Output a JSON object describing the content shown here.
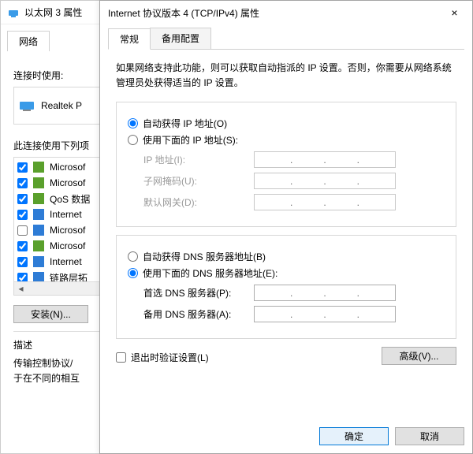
{
  "back": {
    "title": "以太网 3 属性",
    "tab_network": "网络",
    "connect_using_label": "连接时使用:",
    "adapter_name": "Realtek P",
    "items_label": "此连接使用下列项",
    "items": [
      {
        "checked": true,
        "label": "Microsof"
      },
      {
        "checked": true,
        "label": "Microsof"
      },
      {
        "checked": true,
        "label": "QoS 数据"
      },
      {
        "checked": true,
        "label": "Internet"
      },
      {
        "checked": false,
        "label": "Microsof"
      },
      {
        "checked": true,
        "label": "Microsof"
      },
      {
        "checked": true,
        "label": "Internet"
      },
      {
        "checked": true,
        "label": "链路层拓"
      }
    ],
    "install_btn": "安装(N)...",
    "desc_heading": "描述",
    "desc_text": "传输控制协议/\n于在不同的相互"
  },
  "front": {
    "title": "Internet 协议版本 4 (TCP/IPv4) 属性",
    "close": "×",
    "tab_general": "常规",
    "tab_alt": "备用配置",
    "help": "如果网络支持此功能，则可以获取自动指派的 IP 设置。否则，你需要从网络系统管理员处获得适当的 IP 设置。",
    "ip_auto": "自动获得 IP 地址(O)",
    "ip_manual": "使用下面的 IP 地址(S):",
    "ip_label": "IP 地址(I):",
    "mask_label": "子网掩码(U):",
    "gw_label": "默认网关(D):",
    "dns_auto": "自动获得 DNS 服务器地址(B)",
    "dns_manual": "使用下面的 DNS 服务器地址(E):",
    "dns1_label": "首选 DNS 服务器(P):",
    "dns2_label": "备用 DNS 服务器(A):",
    "validate": "退出时验证设置(L)",
    "advanced": "高级(V)...",
    "ok": "确定",
    "cancel": "取消"
  }
}
